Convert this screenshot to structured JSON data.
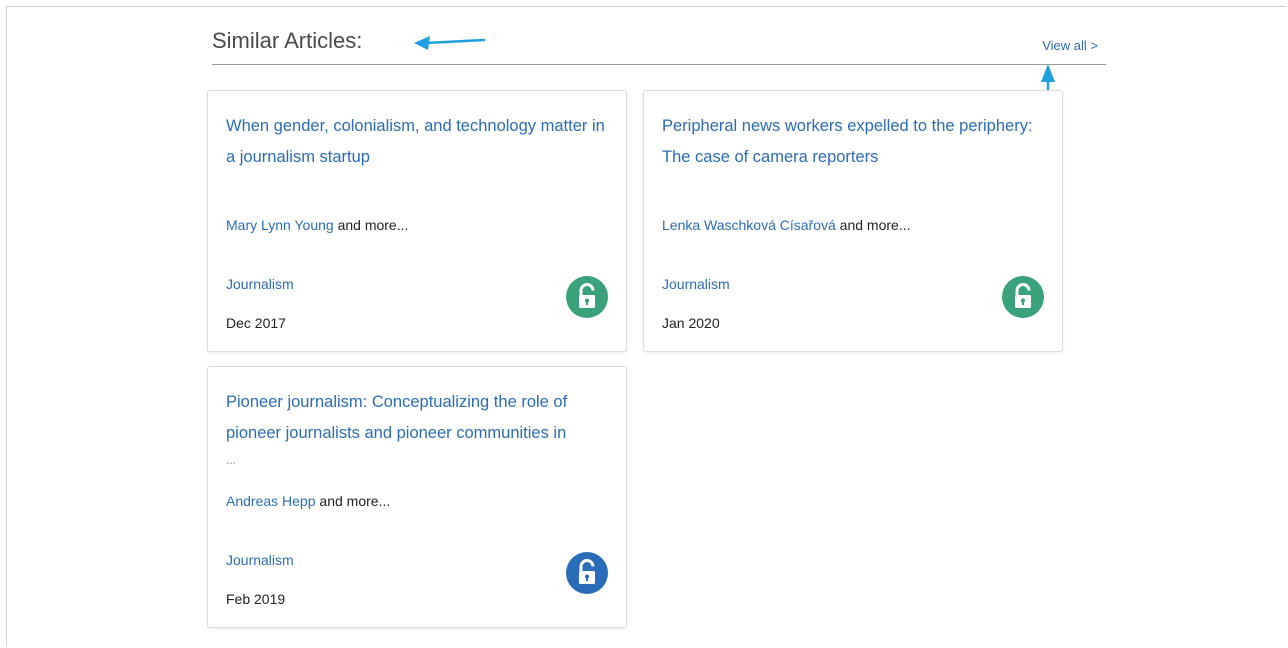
{
  "section": {
    "title": "Similar Articles:",
    "view_all": "View all >"
  },
  "colors": {
    "link": "#2b6cb8",
    "annotation_arrow": "#1ea0e0",
    "open_access_green": "#3aa27a",
    "open_access_blue": "#2b6cb8"
  },
  "articles": [
    {
      "title": "When gender, colonialism, and technology matter in a journalism startup",
      "ellipsis": "",
      "author": "Mary Lynn Young",
      "author_suffix": " and more...",
      "subject": "Journalism",
      "date": "Dec 2017",
      "icon": "open-lock-icon",
      "icon_color": "#3aa27a"
    },
    {
      "title": "Peripheral news workers expelled to the periphery: The case of camera reporters",
      "ellipsis": "",
      "author": "Lenka Waschková Císařová",
      "author_suffix": " and more...",
      "subject": "Journalism",
      "date": "Jan 2020",
      "icon": "open-lock-icon",
      "icon_color": "#3aa27a"
    },
    {
      "title": "Pioneer journalism: Conceptualizing the role of pioneer journalists and pioneer communities in",
      "ellipsis": "...",
      "author": "Andreas Hepp",
      "author_suffix": " and more...",
      "subject": "Journalism",
      "date": "Feb 2019",
      "icon": "open-lock-icon",
      "icon_color": "#2b6cb8"
    }
  ]
}
